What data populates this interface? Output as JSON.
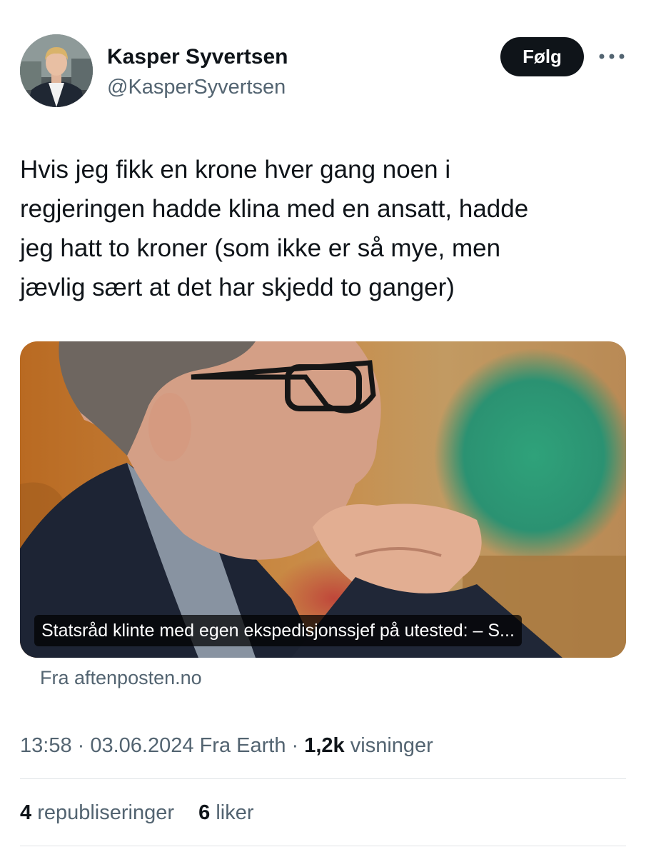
{
  "author": {
    "name": "Kasper Syvertsen",
    "handle": "@KasperSyvertsen"
  },
  "actions": {
    "follow_label": "Følg",
    "more_icon": "more-horizontal-icon"
  },
  "tweet": {
    "lines": [
      "Hvis jeg fikk en krone hver gang noen i",
      "regjeringen hadde klina med en ansatt, hadde",
      "jeg hatt to kroner (som ikke er så mye, men",
      "jævlig sært at det har skjedd to ganger)"
    ]
  },
  "card": {
    "caption": "Statsråd klinte med egen ekspedisjonssjef på utested: – S...",
    "source": "Fra aftenposten.no"
  },
  "meta": {
    "time": "13:58",
    "sep1": " · ",
    "date": "03.06.2024",
    "origin": " Fra Earth",
    "sep2": " · ",
    "views": "1,2k",
    "views_label": " visninger"
  },
  "stats": {
    "reposts": "4",
    "reposts_label": " republiseringer",
    "likes": "6",
    "likes_label": " liker"
  },
  "colors": {
    "text": "#0f1419",
    "secondary": "#536471",
    "divider": "#dfe3e6",
    "button_bg": "#0f1419"
  }
}
